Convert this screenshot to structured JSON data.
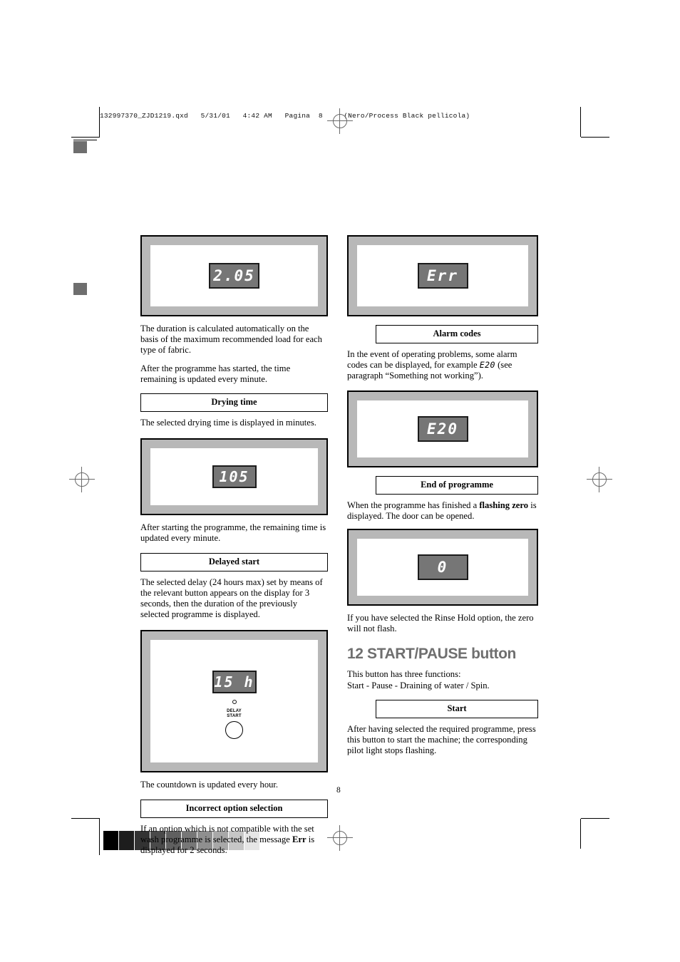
{
  "prepress": {
    "slug": "132997370_ZJD1219.qxd   5/31/01   4:42 AM   Pagina  8     (Nero/Process Black pellicola)",
    "grayscale_swatches": [
      "#000000",
      "#1d1d1d",
      "#333333",
      "#4a4a4a",
      "#606060",
      "#777777",
      "#8f8f8f",
      "#a8a8a8",
      "#c6c6c6",
      "#e6e6e6"
    ]
  },
  "folio": {
    "page_number": "8"
  },
  "left_column": {
    "display_1": {
      "lcd_value": "2.05"
    },
    "para_1": "The duration is calculated automatically on the basis of the maximum recommended load for each type of fabric.",
    "para_2": "After the programme has started, the time remaining is updated every minute.",
    "heading_drying_time": "Drying time",
    "para_3": "The selected drying time is displayed in minutes.",
    "display_2": {
      "lcd_value": "105"
    },
    "para_4": "After starting the programme, the remaining time is updated every minute.",
    "heading_delayed_start": "Delayed start",
    "para_5": "The selected delay (24 hours max) set by means of the relevant button appears on the display for 3 seconds, then the duration of the previously selected programme is displayed.",
    "display_3": {
      "lcd_value": "15 h",
      "button_label_line1": "DELAY",
      "button_label_line2": "START"
    },
    "para_6": "The countdown is updated every hour.",
    "heading_incorrect_option": "Incorrect option selection",
    "para_7_part1": "If an option which is not compatible with the set wash programme is selected, the message ",
    "para_7_bold": "Err",
    "para_7_part2": " is displayed for 2 seconds."
  },
  "right_column": {
    "display_4": {
      "lcd_value": "Err"
    },
    "heading_alarm_codes": "Alarm codes",
    "para_1_part1": "In the event of operating problems, some alarm codes can be displayed, for example ",
    "para_1_lcd": "E20",
    "para_1_part2": " (see paragraph “Something not working”).",
    "display_5": {
      "lcd_value": "E20"
    },
    "heading_end_of_programme": "End of programme",
    "para_2_part1": "When the programme has finished a ",
    "para_2_bold": "flashing zero",
    "para_2_part2": " is displayed. The door can be opened.",
    "display_6": {
      "lcd_value": "0"
    },
    "para_3": "If you have selected the Rinse Hold option, the zero will not flash.",
    "section_heading": "12 START/PAUSE button",
    "para_4_line1": "This button has three functions:",
    "para_4_line2": "Start - Pause - Draining of water / Spin.",
    "heading_start": "Start",
    "para_5": "After having selected the required programme, press this button to start the machine; the corresponding pilot light stops flashing."
  }
}
